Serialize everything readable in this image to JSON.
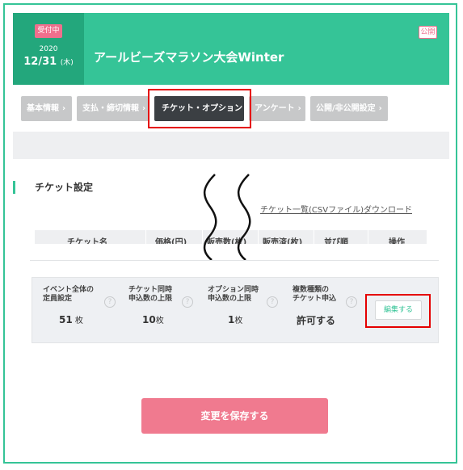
{
  "event": {
    "status_badge": "受付中",
    "year": "2020",
    "date": "12/31",
    "weekday": "(木)",
    "title": "アールビーズマラソン大会Winter",
    "visibility_badge": "公開"
  },
  "tabs": [
    {
      "label": "基本情報"
    },
    {
      "label": "支払・締切情報"
    },
    {
      "label": "チケット・オプション",
      "active": true
    },
    {
      "label": "アンケート"
    },
    {
      "label": "公開/非公開設定"
    }
  ],
  "ticket_section": {
    "title": "チケット設定",
    "csv_link": "チケット一覧(CSVファイル)ダウンロード",
    "columns": [
      "チケット名",
      "価格(円)",
      "販売数(枚)",
      "販売済(枚)",
      "並び順",
      "操作"
    ]
  },
  "settings": [
    {
      "label_line1": "イベント全体の",
      "label_line2": "定員設定",
      "value": "51",
      "unit": " 枚"
    },
    {
      "label_line1": "チケット同時",
      "label_line2": "申込数の上限",
      "value": "10",
      "unit": "枚"
    },
    {
      "label_line1": "オプション同時",
      "label_line2": "申込数の上限",
      "value": "1",
      "unit": "枚"
    },
    {
      "label_line1": "複数種類の",
      "label_line2": "チケット申込",
      "value": "許可する",
      "unit": ""
    }
  ],
  "help_glyph": "?",
  "edit_button": "編集する",
  "save_button": "変更を保存する",
  "chevron": "›",
  "colors": {
    "primary_green": "#35c497",
    "dark_green": "#23a77c",
    "pink": "#f07a8f",
    "highlight_red": "#e50000"
  }
}
